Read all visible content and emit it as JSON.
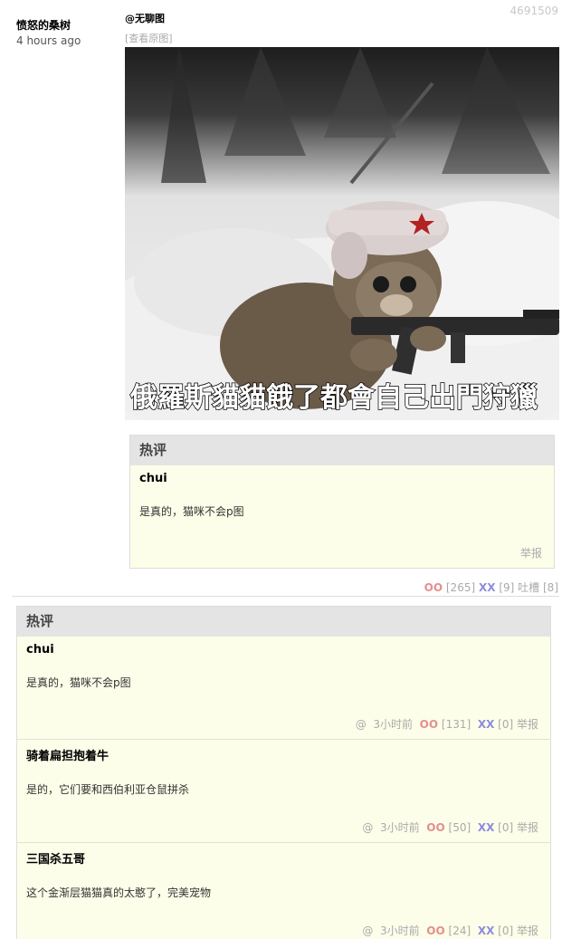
{
  "post": {
    "id": "4691509",
    "author": "愤怒的桑树",
    "time": "4 hours ago",
    "mention": "@无聊图",
    "view_original": "[查看原图]",
    "image_caption": "俄羅斯貓貓餓了都會自己出門狩獵"
  },
  "inner_hot": {
    "header": "热评",
    "comment": {
      "author": "chui",
      "text": "是真的，猫咪不会p图",
      "report": "举报"
    }
  },
  "post_votes": {
    "oo_label": "OO",
    "oo_count": "[265]",
    "xx_label": "XX",
    "xx_count": "[9]",
    "tucao_label": "吐槽",
    "tucao_count": "[8]"
  },
  "hot_comments": {
    "header": "热评",
    "items": [
      {
        "author": "chui",
        "text": "是真的，猫咪不会p图",
        "at": "@",
        "time": "3小时前",
        "oo": "OO",
        "oo_count": "[131]",
        "xx": "XX",
        "xx_count": "[0]",
        "report": "举报"
      },
      {
        "author": "骑着扁担抱着牛",
        "text": "是的，它们要和西伯利亚仓鼠拼杀",
        "at": "@",
        "time": "3小时前",
        "oo": "OO",
        "oo_count": "[50]",
        "xx": "XX",
        "xx_count": "[0]",
        "report": "举报"
      },
      {
        "author": "三国杀五哥",
        "text": "这个金渐层猫猫真的太憨了，完美宠物",
        "at": "@",
        "time": "3小时前",
        "oo": "OO",
        "oo_count": "[24]",
        "xx": "XX",
        "xx_count": "[0]",
        "report": "举报"
      }
    ]
  }
}
